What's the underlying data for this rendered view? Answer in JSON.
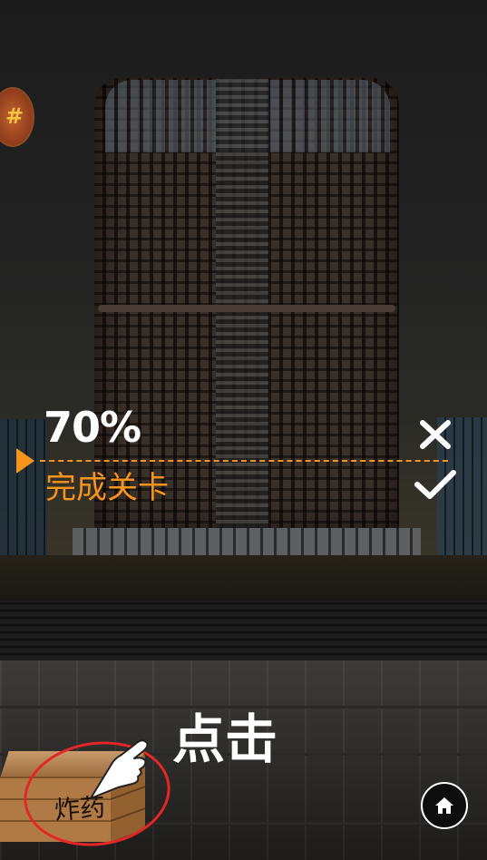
{
  "game": {
    "progress_percent": "70%",
    "progress_level": 0.7,
    "objective_label": "完成关卡",
    "tap_prompt": "点击",
    "explosive_box_label": "炸药",
    "corner_badge_icon": "coin-icon",
    "colors": {
      "accent_orange": "#f7941d",
      "ring_red": "#e32626",
      "text_white": "#ffffff"
    },
    "icons": {
      "fail": "close-x-icon",
      "success": "checkmark-icon",
      "pointer": "pointing-hand-icon",
      "home": "home-icon"
    }
  }
}
